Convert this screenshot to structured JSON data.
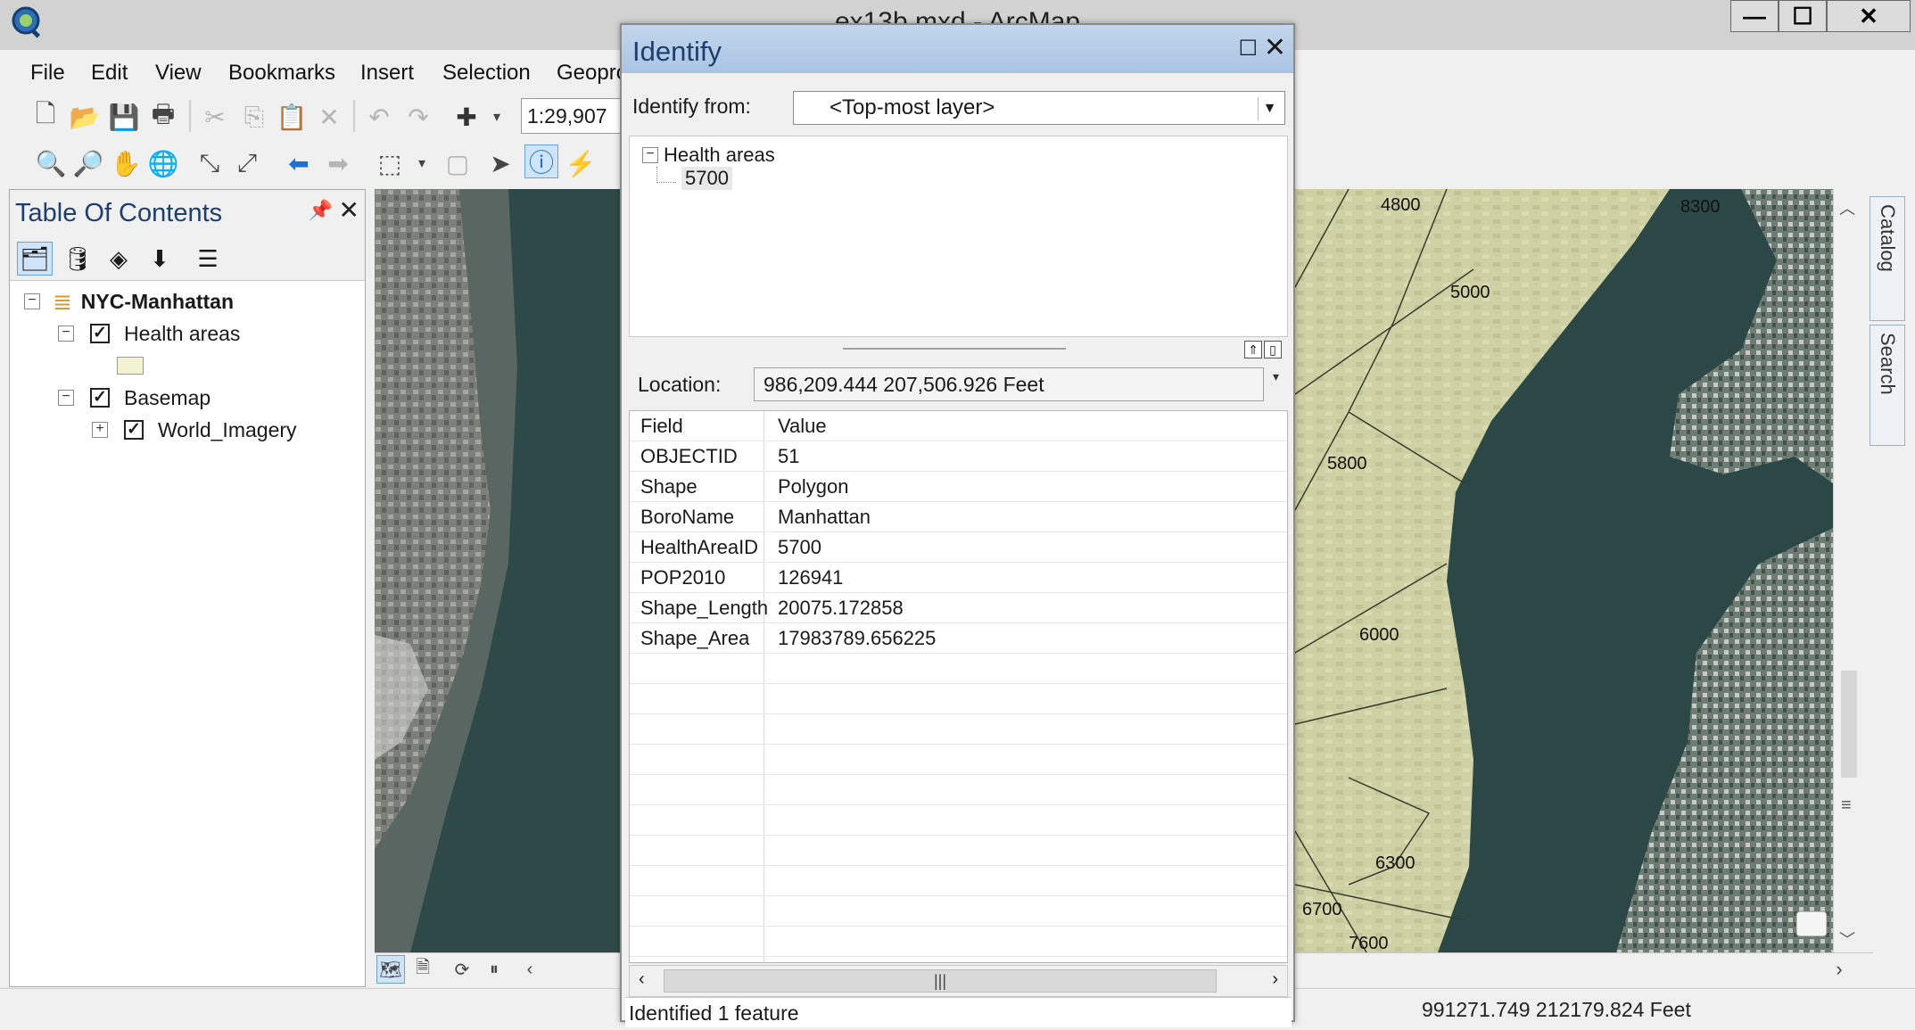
{
  "window": {
    "title": "ex13b.mxd - ArcMap",
    "min_glyph": "—",
    "max_glyph": "☐",
    "close_glyph": "✕"
  },
  "menu": [
    "File",
    "Edit",
    "View",
    "Bookmarks",
    "Insert",
    "Selection",
    "Geopro"
  ],
  "toolbar": {
    "scale": "1:29,907"
  },
  "toc": {
    "title": "Table Of Contents",
    "pin_glyph": "📌",
    "close_glyph": "✕",
    "tree": [
      {
        "label": "NYC-Manhattan",
        "kind": "group",
        "expander": "−"
      },
      {
        "label": "Health areas",
        "kind": "layer",
        "expander": "−",
        "checked": "✓",
        "swatch_color": "#f3f2d3"
      },
      {
        "label": "Basemap",
        "kind": "layer",
        "expander": "−",
        "checked": "✓"
      },
      {
        "label": "World_Imagery",
        "kind": "sublayer",
        "expander": "+",
        "checked": "✓"
      }
    ]
  },
  "map": {
    "labels": [
      "4800",
      "8300",
      "5000",
      "5800",
      "6000",
      "6300",
      "6700",
      "7600"
    ],
    "status_coords": "991271.749  212179.824 Feet",
    "side_tabs": [
      "Catalog",
      "Search"
    ]
  },
  "identify": {
    "title": "Identify",
    "max_glyph": "☐",
    "close_glyph": "✕",
    "from_label": "Identify from:",
    "from_value": "<Top-most layer>",
    "tree_layer": "Health areas",
    "tree_feature": "5700",
    "location_label": "Location:",
    "location_value": "986,209.444  207,506.926 Feet",
    "table": {
      "headers": [
        "Field",
        "Value"
      ],
      "rows": [
        [
          "OBJECTID",
          "51"
        ],
        [
          "Shape",
          "Polygon"
        ],
        [
          "BoroName",
          "Manhattan"
        ],
        [
          "HealthAreaID",
          "5700"
        ],
        [
          "POP2010",
          "126941"
        ],
        [
          "Shape_Length",
          "20075.172858"
        ],
        [
          "Shape_Area",
          "17983789.656225"
        ]
      ]
    },
    "status": "Identified 1 feature"
  },
  "colors": {
    "health_area_fill": "#cfd1a5",
    "river": "#2b4846",
    "title_blue": "#1e3f6e"
  }
}
